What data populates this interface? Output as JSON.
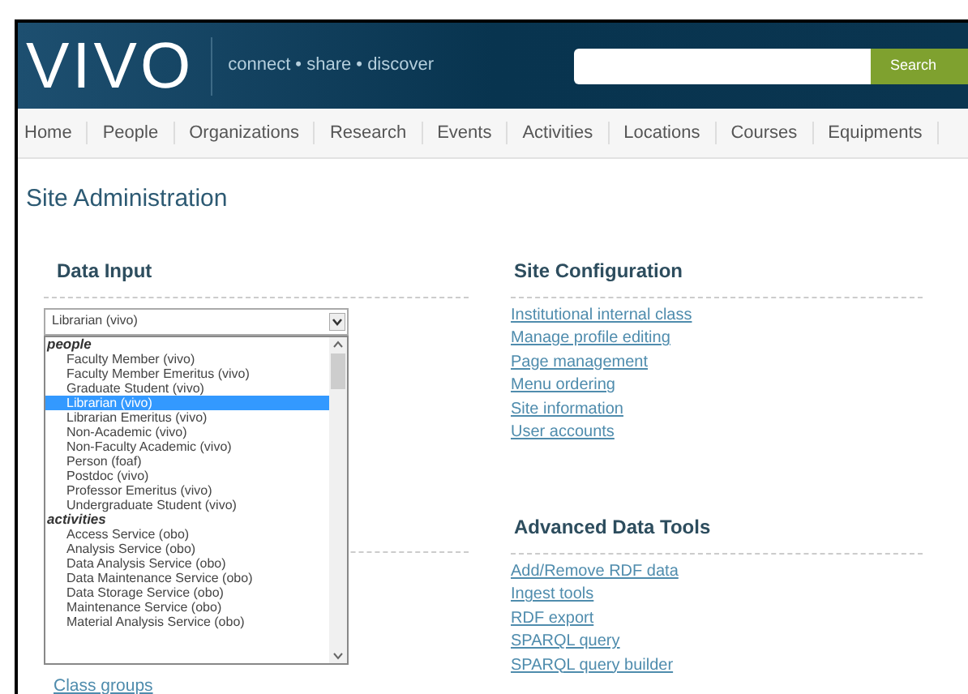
{
  "header": {
    "logo": "VIVO",
    "tagline": "connect • share • discover",
    "search_button": "Search"
  },
  "nav": [
    {
      "label": "Home"
    },
    {
      "label": "People"
    },
    {
      "label": "Organizations"
    },
    {
      "label": "Research"
    },
    {
      "label": "Events"
    },
    {
      "label": "Activities"
    },
    {
      "label": "Locations"
    },
    {
      "label": "Courses"
    },
    {
      "label": "Equipments"
    }
  ],
  "page_title": "Site Administration",
  "data_input": {
    "title": "Data Input",
    "select_value": "Librarian (vivo)",
    "groups": [
      {
        "label": "people",
        "options": [
          {
            "label": "Faculty Member (vivo)",
            "selected": false
          },
          {
            "label": "Faculty Member Emeritus (vivo)",
            "selected": false
          },
          {
            "label": "Graduate Student (vivo)",
            "selected": false
          },
          {
            "label": "Librarian (vivo)",
            "selected": true
          },
          {
            "label": "Librarian Emeritus (vivo)",
            "selected": false
          },
          {
            "label": "Non-Academic (vivo)",
            "selected": false
          },
          {
            "label": "Non-Faculty Academic (vivo)",
            "selected": false
          },
          {
            "label": "Person (foaf)",
            "selected": false
          },
          {
            "label": "Postdoc (vivo)",
            "selected": false
          },
          {
            "label": "Professor Emeritus (vivo)",
            "selected": false
          },
          {
            "label": "Undergraduate Student (vivo)",
            "selected": false
          }
        ]
      },
      {
        "label": "activities",
        "options": [
          {
            "label": "Access Service (obo)",
            "selected": false
          },
          {
            "label": "Analysis Service (obo)",
            "selected": false
          },
          {
            "label": "Data Analysis Service (obo)",
            "selected": false
          },
          {
            "label": "Data Maintenance Service (obo)",
            "selected": false
          },
          {
            "label": "Data Storage Service (obo)",
            "selected": false
          },
          {
            "label": "Maintenance Service (obo)",
            "selected": false
          },
          {
            "label": "Material Analysis Service (obo)",
            "selected": false
          }
        ]
      }
    ],
    "link": "Class groups"
  },
  "site_configuration": {
    "title": "Site Configuration",
    "links": [
      "Institutional internal class",
      "Manage profile editing",
      "Page management",
      "Menu ordering",
      "Site information",
      "User accounts"
    ]
  },
  "advanced_data_tools": {
    "title": "Advanced Data Tools",
    "links": [
      "Add/Remove RDF data",
      "Ingest tools",
      "RDF export",
      "SPARQL query",
      "SPARQL query builder"
    ]
  }
}
